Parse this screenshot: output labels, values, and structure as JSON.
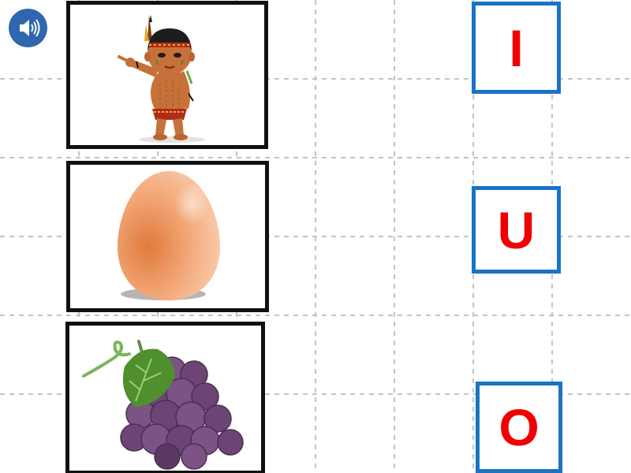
{
  "colors": {
    "letter": "#f00000",
    "letter_border": "#1a73c4",
    "card_border": "#111111",
    "grid_line": "#c4c4c4",
    "sound_button": "#2f66ae"
  },
  "sound_button": {
    "icon": "speaker-icon"
  },
  "pictures": [
    {
      "id": "boy",
      "subject": "native-boy-picture"
    },
    {
      "id": "egg",
      "subject": "egg-picture"
    },
    {
      "id": "grape",
      "subject": "grapes-picture"
    }
  ],
  "letters": [
    {
      "id": "i",
      "text": "I"
    },
    {
      "id": "u",
      "text": "U"
    },
    {
      "id": "o",
      "text": "O"
    }
  ]
}
